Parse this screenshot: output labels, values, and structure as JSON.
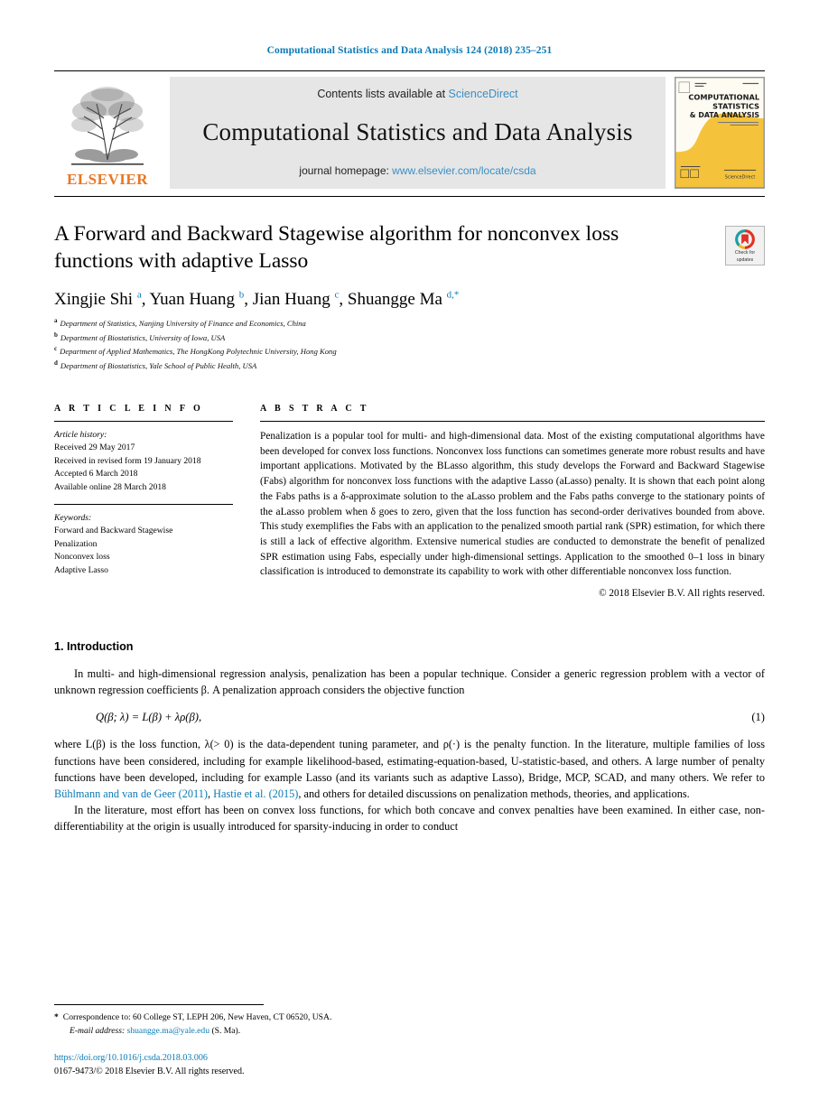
{
  "running_head": "Computational Statistics and Data Analysis 124 (2018) 235–251",
  "masthead": {
    "publisher": "ELSEVIER",
    "contents_prefix": "Contents lists available at",
    "contents_link": "ScienceDirect",
    "journal_name": "Computational Statistics and Data Analysis",
    "homepage_prefix": "journal homepage:",
    "homepage_link": "www.elsevier.com/locate/csda",
    "cover": {
      "line1": "COMPUTATIONAL",
      "line2": "STATISTICS",
      "line3": "& DATA ANALYSIS",
      "footer_brand": "ScienceDirect"
    }
  },
  "article": {
    "title": "A Forward and Backward Stagewise algorithm for nonconvex loss functions with adaptive Lasso",
    "crossmark_line1": "Check for",
    "crossmark_line2": "updates",
    "authors_html": "Xingjie Shi <sup>a</sup>, Yuan Huang <sup>b</sup>, Jian Huang <sup>c</sup>, Shuangge Ma <sup>d,*</sup>",
    "affiliations": [
      {
        "mark": "a",
        "text": "Department of Statistics, Nanjing University of Finance and Economics, China"
      },
      {
        "mark": "b",
        "text": "Department of Biostatistics, University of Iowa, USA"
      },
      {
        "mark": "c",
        "text": "Department of Applied Mathematics, The HongKong Polytechnic University, Hong Kong"
      },
      {
        "mark": "d",
        "text": "Department of Biostatistics, Yale School of Public Health, USA"
      }
    ]
  },
  "info": {
    "heading": "A R T I C L E   I N F O",
    "history_label": "Article history:",
    "history": [
      "Received 29 May 2017",
      "Received in revised form 19 January 2018",
      "Accepted 6 March 2018",
      "Available online 28 March 2018"
    ],
    "keywords_label": "Keywords:",
    "keywords": [
      "Forward and Backward Stagewise",
      "Penalization",
      "Nonconvex loss",
      "Adaptive Lasso"
    ]
  },
  "abstract": {
    "heading": "A B S T R A C T",
    "text": "Penalization is a popular tool for multi- and high-dimensional data. Most of the existing computational algorithms have been developed for convex loss functions. Nonconvex loss functions can sometimes generate more robust results and have important applications. Motivated by the BLasso algorithm, this study develops the Forward and Backward Stagewise (Fabs) algorithm for nonconvex loss functions with the adaptive Lasso (aLasso) penalty. It is shown that each point along the Fabs paths is a δ-approximate solution to the aLasso problem and the Fabs paths converge to the stationary points of the aLasso problem when δ goes to zero, given that the loss function has second-order derivatives bounded from above. This study exemplifies the Fabs with an application to the penalized smooth partial rank (SPR) estimation, for which there is still a lack of effective algorithm. Extensive numerical studies are conducted to demonstrate the benefit of penalized SPR estimation using Fabs, especially under high-dimensional settings. Application to the smoothed 0–1 loss in binary classification is introduced to demonstrate its capability to work with other differentiable nonconvex loss function.",
    "copyright": "© 2018 Elsevier B.V. All rights reserved."
  },
  "introduction": {
    "heading": "1. Introduction",
    "para1": "In multi- and high-dimensional regression analysis, penalization has been a popular technique. Consider a generic regression problem with a vector of unknown regression coefficients β. A penalization approach considers the objective function",
    "equation": "Q(β; λ) = L(β) + λρ(β),",
    "equation_number": "(1)",
    "para2_a": "where L(β) is the loss function, λ(> 0) is the data-dependent tuning parameter, and ρ(·) is the penalty function. In the literature, multiple families of loss functions have been considered, including for example likelihood-based, estimating-equation-based, U-statistic-based, and others. A large number of penalty functions have been developed, including for example Lasso (and its variants such as adaptive Lasso), Bridge, MCP, SCAD, and many others. We refer to ",
    "cite1": "Bühlmann and van de Geer",
    "cite1_year": "(2011)",
    "cite2": "Hastie et al.",
    "cite2_year": "(2015)",
    "para2_b": ", and others for detailed discussions on penalization methods, theories, and applications.",
    "para3": "In the literature, most effort has been on convex loss functions, for which both concave and convex penalties have been examined. In either case, non-differentiability at the origin is usually introduced for sparsity-inducing in order to conduct"
  },
  "footnotes": {
    "correspondence": "Correspondence to: 60 College ST, LEPH 206, New Haven, CT 06520, USA.",
    "email_label": "E-mail address:",
    "email": "shuangge.ma@yale.edu",
    "email_suffix": "(S. Ma)."
  },
  "footer": {
    "doi": "https://doi.org/10.1016/j.csda.2018.03.006",
    "issn": "0167-9473/© 2018 Elsevier B.V. All rights reserved."
  },
  "colors": {
    "link": "#0b7ab5",
    "elsevier_orange": "#e87722",
    "masthead_bg": "#e6e6e6"
  }
}
